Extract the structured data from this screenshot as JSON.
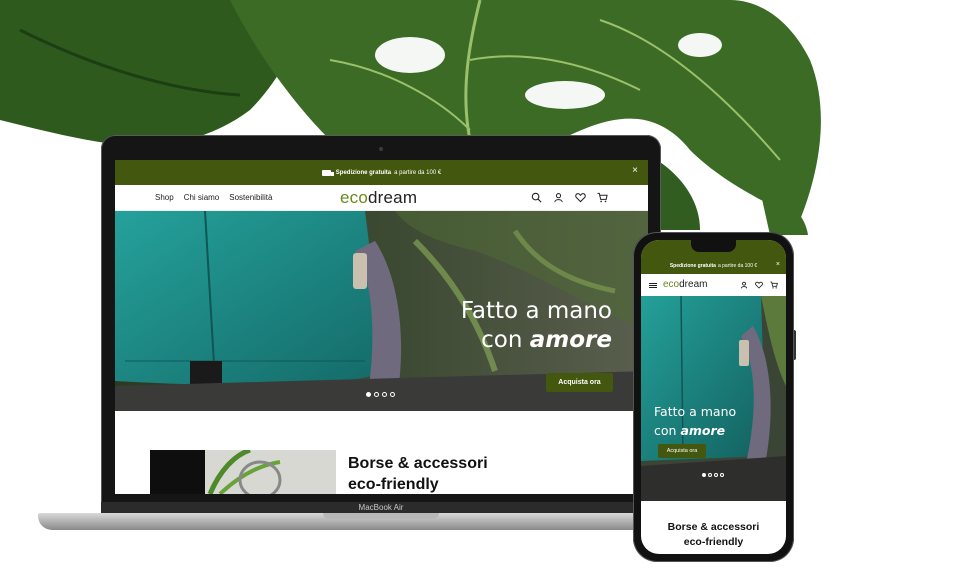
{
  "announcement": {
    "bold": "Spedizione gratuita",
    "rest": "a partire da 100 €",
    "close": "×"
  },
  "logo": {
    "eco": "eco",
    "dream": "dream"
  },
  "nav": {
    "links": [
      "Shop",
      "Chi siamo",
      "Sostenibilità"
    ]
  },
  "icons": [
    "search-icon",
    "user-icon",
    "heart-icon",
    "cart-icon"
  ],
  "hero": {
    "line1": "Fatto a mano",
    "line2_plain": "con",
    "line2_emph": "amore",
    "cta": "Acquista ora",
    "slides": 4,
    "active_slide": 1
  },
  "section": {
    "line1": "Borse & accessori",
    "line2": "eco-friendly"
  },
  "device_label": "MacBook Air",
  "colors": {
    "brand_green": "#44570e",
    "logo_green": "#6a8a1c",
    "teal_bag": "#1e8a86"
  }
}
